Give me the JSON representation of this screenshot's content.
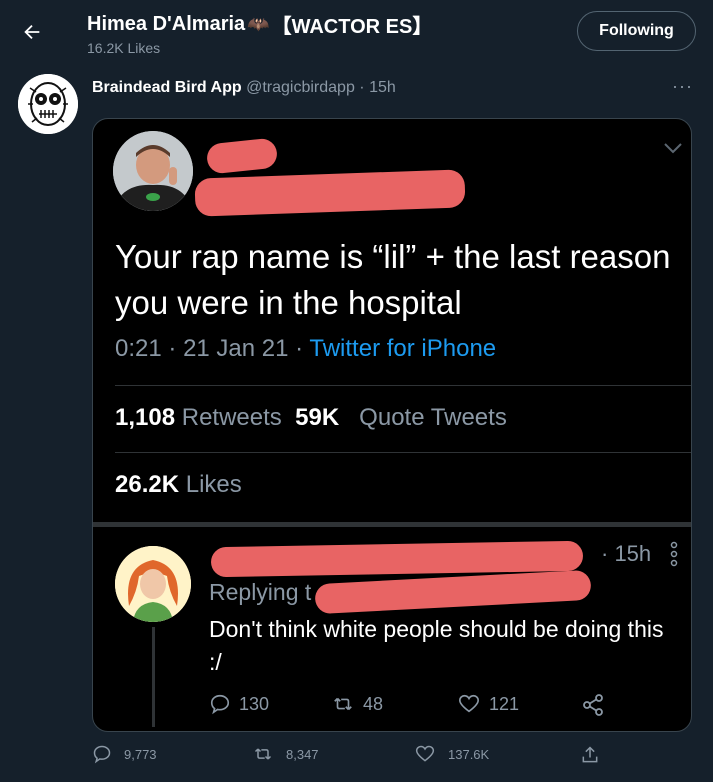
{
  "header": {
    "title": "Himea D'Almaria",
    "title_tag": "【WACTOR ES】",
    "subtitle": "16.2K Likes",
    "follow_label": "Following",
    "bat_emoji": "🦇"
  },
  "tweet": {
    "author_name": "Braindead Bird App",
    "author_handle": "@tragicbirdapp",
    "separator": "·",
    "time": "15h",
    "more_label": "···"
  },
  "media": {
    "text": "Your rap name is “lil” + the last reason you were in the hospital",
    "time": "0:21",
    "sep": "·",
    "date": "21 Jan 21",
    "source": "Twitter for iPhone",
    "retweets_count": "1,108",
    "retweets_label": "Retweets",
    "quotes_count": "59K",
    "quotes_label": "Quote Tweets",
    "likes_count": "26.2K",
    "likes_label": "Likes",
    "reply": {
      "time": "· 15h",
      "replying": "Replying t",
      "text": "Don't think white people should be doing this :/",
      "replies": "130",
      "retweets": "48",
      "likes": "121"
    }
  },
  "actions": {
    "replies": "9,773",
    "retweets": "8,347",
    "likes": "137.6K"
  },
  "colors": {
    "background": "#15202b",
    "muted": "#8b98a5",
    "accent": "#1d9bf0",
    "redaction": "#e86464"
  }
}
